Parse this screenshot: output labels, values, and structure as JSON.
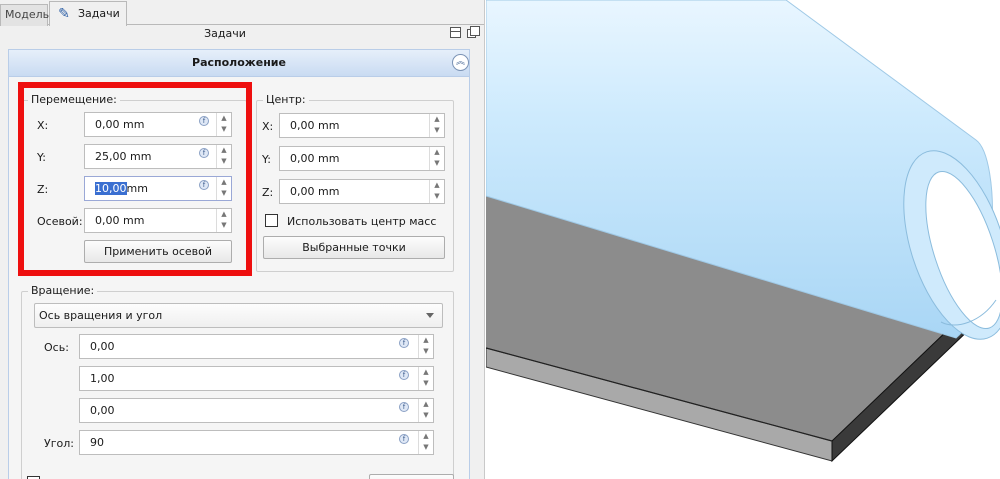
{
  "tabs": {
    "model": "Модель",
    "tasks": "Задачи"
  },
  "dock": {
    "title": "Задачи"
  },
  "placement": {
    "header": "Расположение",
    "translation": {
      "title": "Перемещение:",
      "x_label": "X:",
      "x_value": "0,00 mm",
      "y_label": "Y:",
      "y_value": "25,00 mm",
      "z_label": "Z:",
      "z_value_selected": "10,00",
      "z_value_unit": "mm",
      "axial_label": "Осевой:",
      "axial_value": "0,00 mm",
      "apply_axial_button": "Применить осевой"
    },
    "center": {
      "title": "Центр:",
      "x_label": "X:",
      "x_value": "0,00 mm",
      "y_label": "Y:",
      "y_value": "0,00 mm",
      "z_label": "Z:",
      "z_value": "0,00 mm",
      "center_of_mass_label": "Использовать центр масс",
      "center_of_mass_checked": false,
      "selected_points_button": "Выбранные точки"
    },
    "rotation": {
      "title": "Вращение:",
      "mode": "Ось вращения и угол",
      "axis_label": "Ось:",
      "axis_x": "0,00",
      "axis_y": "1,00",
      "axis_z": "0,00",
      "angle_label": "Угол:",
      "angle_value": "90"
    }
  },
  "icons": {
    "tab_tasks_icon": "pencil-icon",
    "expression_icon": "expression-icon",
    "collapse_icon": "double-chevron-up-icon"
  },
  "colors": {
    "highlight": "#ee0f0f",
    "header_gradient_top": "#e6effa",
    "header_gradient_bottom": "#c9dbf2",
    "cylinder": "#bfe3fb",
    "plate_top": "#8c8c8c",
    "plate_side": "#a9a9a9",
    "selection": "#3a6fd1"
  }
}
